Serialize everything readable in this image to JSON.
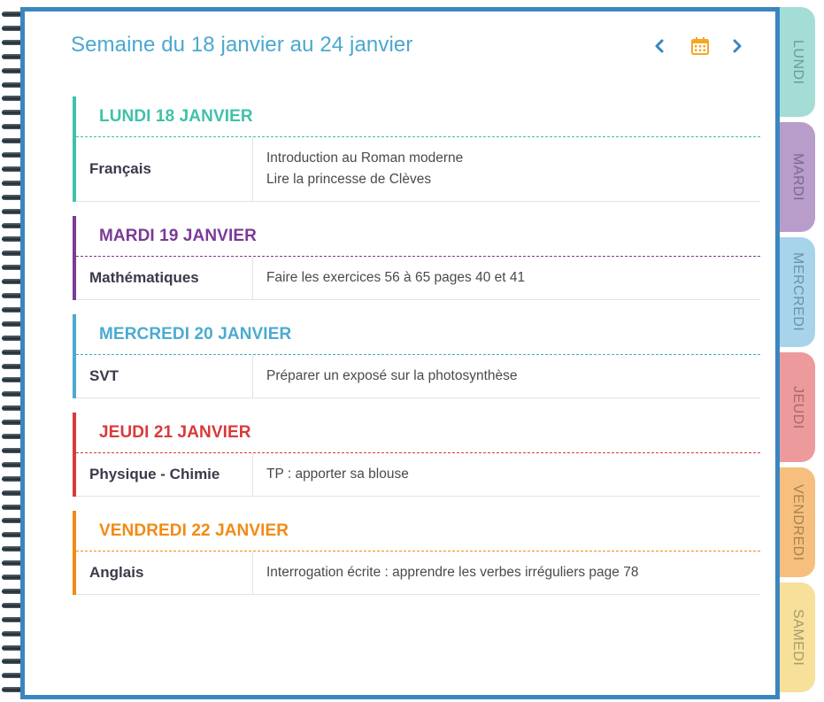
{
  "header": {
    "title": "Semaine du 18 janvier au 24 janvier"
  },
  "icons": {
    "prev": "chevron-left-icon",
    "calendar": "calendar-icon",
    "next": "chevron-right-icon"
  },
  "colors": {
    "binding": "#3a86c0",
    "title": "#4aa8cf",
    "calendar": "#f5a623"
  },
  "days": [
    {
      "header": "LUNDI 18 JANVIER",
      "color": "#3fc1aa",
      "entries": [
        {
          "subject": "Français",
          "tasks": [
            "Introduction au Roman moderne",
            "Lire la princesse de Clèves"
          ]
        }
      ]
    },
    {
      "header": "MARDI 19 JANVIER",
      "color": "#7b3a96",
      "entries": [
        {
          "subject": "Mathématiques",
          "tasks": [
            "Faire les exercices 56 à 65 pages 40 et 41"
          ]
        }
      ]
    },
    {
      "header": "MERCREDI 20 JANVIER",
      "color": "#4aabd1",
      "entries": [
        {
          "subject": "SVT",
          "tasks": [
            "Préparer un exposé sur la photosynthèse"
          ]
        }
      ]
    },
    {
      "header": "JEUDI 21 JANVIER",
      "color": "#d93a3a",
      "entries": [
        {
          "subject": "Physique - Chimie",
          "tasks": [
            "TP : apporter sa blouse"
          ]
        }
      ]
    },
    {
      "header": "VENDREDI 22 JANVIER",
      "color": "#f28a14",
      "entries": [
        {
          "subject": "Anglais",
          "tasks": [
            "Interrogation écrite : apprendre les verbes irréguliers page 78"
          ]
        }
      ]
    }
  ],
  "tabs": [
    {
      "label": "LUNDI",
      "bg": "#a4ddd6",
      "text": "#6a9a95"
    },
    {
      "label": "MARDI",
      "bg": "#b89cc9",
      "text": "#7a6890"
    },
    {
      "label": "MERCREDI",
      "bg": "#a7d4ea",
      "text": "#6a92a8"
    },
    {
      "label": "JEUDI",
      "bg": "#ec9a9c",
      "text": "#a86868"
    },
    {
      "label": "VENDREDI",
      "bg": "#f7bf7e",
      "text": "#a8814f"
    },
    {
      "label": "SAMEDI",
      "bg": "#f6e09a",
      "text": "#a89a6a"
    }
  ]
}
